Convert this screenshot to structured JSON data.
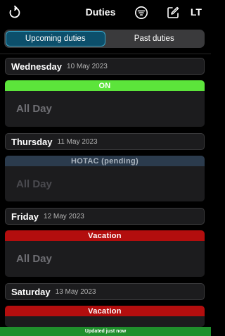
{
  "header": {
    "title": "Duties",
    "initials": "LT",
    "icons": {
      "refresh": "refresh-icon",
      "filter": "filter-icon",
      "edit": "edit-icon"
    }
  },
  "tabs": [
    {
      "label": "Upcoming duties",
      "active": true
    },
    {
      "label": "Past duties",
      "active": false
    }
  ],
  "days": [
    {
      "dow": "Wednesday",
      "date": "10 May 2023",
      "duty": {
        "label": "ON",
        "time": "All Day",
        "color": "#5ce43b"
      }
    },
    {
      "dow": "Thursday",
      "date": "11 May 2023",
      "duty": {
        "label": "HOTAC  (pending)",
        "time": "All Day",
        "color": "#2b3b4d"
      }
    },
    {
      "dow": "Friday",
      "date": "12 May 2023",
      "duty": {
        "label": "Vacation",
        "time": "All Day",
        "color": "#b30e0e"
      }
    },
    {
      "dow": "Saturday",
      "date": "13 May 2023",
      "duty": {
        "label": "Vacation",
        "color": "#b30e0e"
      }
    }
  ],
  "status": {
    "text": "Updated just now",
    "color": "#1f8f2c"
  }
}
